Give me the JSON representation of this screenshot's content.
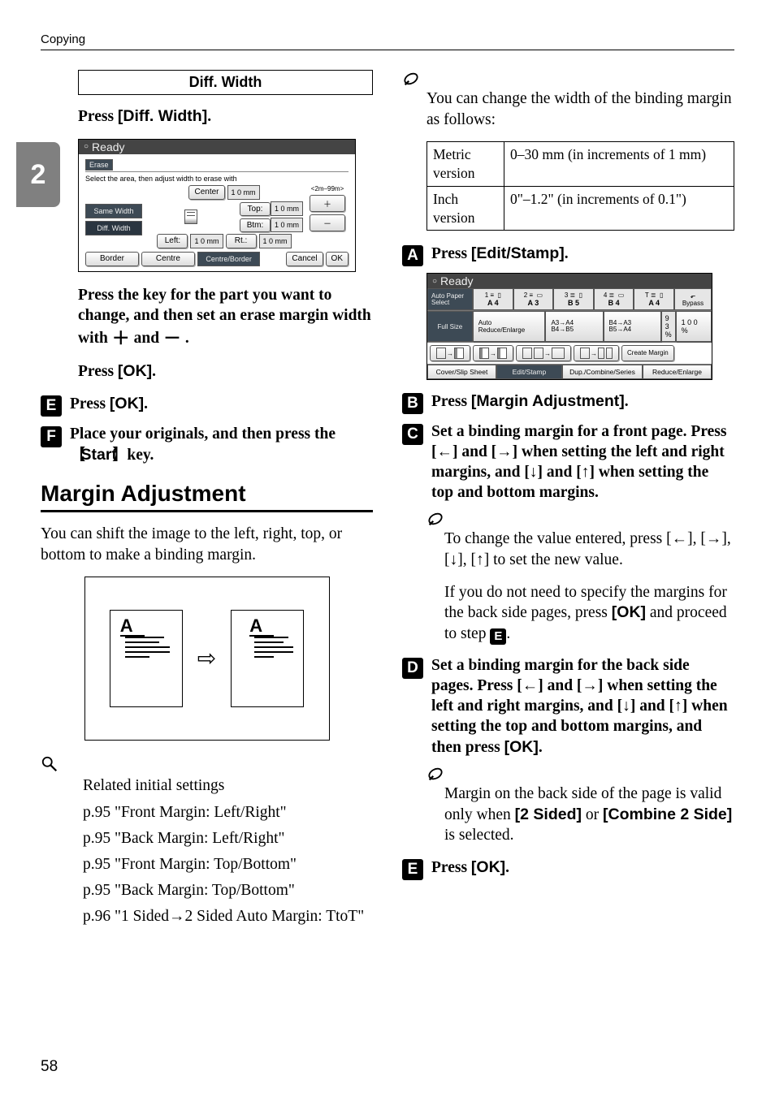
{
  "header": {
    "section": "Copying"
  },
  "sidetab": {
    "num": "2"
  },
  "left": {
    "box_title": "Diff. Width",
    "press_diff": {
      "pre": "Press ",
      "btn": "[Diff. Width]",
      "post": "."
    },
    "shot1": {
      "title": "Ready",
      "tab": "Erase",
      "subtitle": "Select the area, then adjust width to erase with",
      "center": "Center",
      "center_v": "1 0 mm",
      "same": "Same Width",
      "diff": "Diff. Width",
      "top": "Top:",
      "top_v": "1 0 mm",
      "btm": "Btm:",
      "btm_v": "1 0 mm",
      "left": "Left:",
      "left_v": "1 0 mm",
      "right": "Rt.:",
      "right_v": "1 0 mm",
      "border": "Border",
      "centre2": "Centre",
      "cb": "Centre/Border",
      "cancel": "Cancel",
      "ok": "OK",
      "range": "<2m–99m>"
    },
    "para_press_key": "Press the key for the part you want to change, and then set an erase margin width with ",
    "and": "and ",
    "press_ok": {
      "pre": "Press ",
      "btn": "[OK]",
      "post": "."
    },
    "step5": {
      "num": "E",
      "pre": "Press ",
      "btn": "[OK]",
      "post": "."
    },
    "step6": {
      "num": "F",
      "text_a": "Place your originals, and then press the ",
      "key": "Start",
      "text_b": " key."
    },
    "h2": "Margin Adjustment",
    "intro": "You can shift the image to the left, right, top, or bottom to make a binding margin.",
    "fig_a": "A",
    "ref_intro": "Related initial settings",
    "refs": [
      "p.95 \"Front Margin: Left/Right\"",
      "p.95 \"Back Margin: Left/Right\"",
      "p.95 \"Front Margin: Top/Bottom\"",
      "p.95 \"Back Margin: Top/Bottom\"",
      "p.96 \"1 Sided→2 Sided Auto Margin: TtoT\""
    ]
  },
  "right": {
    "note1": "You can change the width of the binding margin as follows:",
    "tbl": {
      "r1c1": "Metric version",
      "r1c2": "0–30 mm (in increments of 1 mm)",
      "r2c1": "Inch version",
      "r2c2": "0\"–1.2\" (in increments of 0.1\")"
    },
    "step1": {
      "num": "A",
      "pre": "Press ",
      "btn": "[Edit/Stamp]",
      "post": "."
    },
    "shot2": {
      "title": "Ready",
      "auto_paper": "Auto Paper Select",
      "sizes": [
        "A 4",
        "A 3",
        "B 5",
        "B 4",
        "A 4"
      ],
      "bypass": "Bypass",
      "full": "Full Size",
      "are": "Auto Reduce/Enlarge",
      "r1": "A3→A4 B4→B5",
      "r2": "B4→A3 B5→A4",
      "pct": "9 3 %",
      "hund": "1 0 0 %",
      "create": "Create Margin",
      "bottom": [
        "Cover/Slip Sheet",
        "Edit/Stamp",
        "Dup./Combine/Series",
        "Reduce/Enlarge"
      ]
    },
    "step2": {
      "num": "B",
      "pre": "Press ",
      "btn": "[Margin Adjustment]",
      "post": "."
    },
    "step3": {
      "num": "C",
      "text": "Set a binding margin for a front page. Press [←] and [→] when setting the left and right margins, and [↓] and [↑] when setting the top and bottom margins."
    },
    "note2a": "To change the value entered, press [←], [→], [↓], [↑] to set the new value.",
    "note2b_a": "If you do not need to specify the margins for the back side pages, press ",
    "note2b_btn": "[OK]",
    "note2b_b": " and proceed to step ",
    "note2b_step": "E",
    "step4": {
      "num": "D",
      "text_a": "Set a binding margin for the back side pages. Press [←] and [→] when setting the left and right margins, and [↓] and [↑] when setting the top and bottom margins, and then press ",
      "btn": "[OK]",
      "post": "."
    },
    "note3_a": "Margin on the back side of the page is valid only when ",
    "note3_b1": "[2 Sided]",
    "note3_mid": " or ",
    "note3_b2": "[Combine 2 Side]",
    "note3_c": " is selected.",
    "step5": {
      "num": "E",
      "pre": "Press ",
      "btn": "[OK]",
      "post": "."
    }
  },
  "page_num": "58"
}
